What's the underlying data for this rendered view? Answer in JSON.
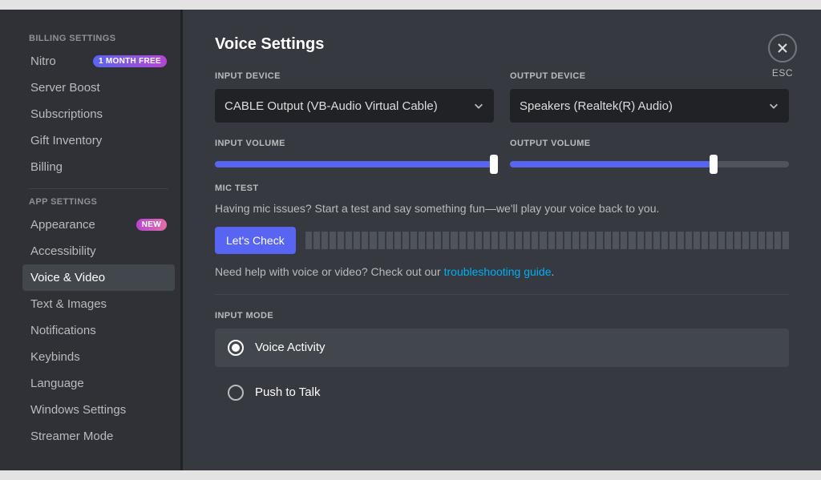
{
  "sidebar": {
    "cat_billing": "BILLING SETTINGS",
    "cat_app": "APP SETTINGS",
    "nitro": "Nitro",
    "nitro_badge": "1 MONTH FREE",
    "server_boost": "Server Boost",
    "subscriptions": "Subscriptions",
    "gift_inventory": "Gift Inventory",
    "billing": "Billing",
    "appearance": "Appearance",
    "appearance_badge": "NEW",
    "accessibility": "Accessibility",
    "voice_video": "Voice & Video",
    "text_images": "Text & Images",
    "notifications": "Notifications",
    "keybinds": "Keybinds",
    "language": "Language",
    "windows_settings": "Windows Settings",
    "streamer_mode": "Streamer Mode"
  },
  "main": {
    "title": "Voice Settings",
    "input_device_label": "INPUT DEVICE",
    "output_device_label": "OUTPUT DEVICE",
    "input_device": "CABLE Output (VB-Audio Virtual Cable)",
    "output_device": "Speakers (Realtek(R) Audio)",
    "input_volume_label": "INPUT VOLUME",
    "output_volume_label": "OUTPUT VOLUME",
    "input_volume_pct": 100,
    "output_volume_pct": 73,
    "mic_test_label": "MIC TEST",
    "mic_test_desc": "Having mic issues? Start a test and say something fun—we'll play your voice back to you.",
    "lets_check": "Let's Check",
    "help_prefix": "Need help with voice or video? Check out our ",
    "help_link": "troubleshooting guide",
    "help_suffix": ".",
    "input_mode_label": "INPUT MODE",
    "mode_voice_activity": "Voice Activity",
    "mode_ptt": "Push to Talk",
    "esc": "ESC"
  }
}
